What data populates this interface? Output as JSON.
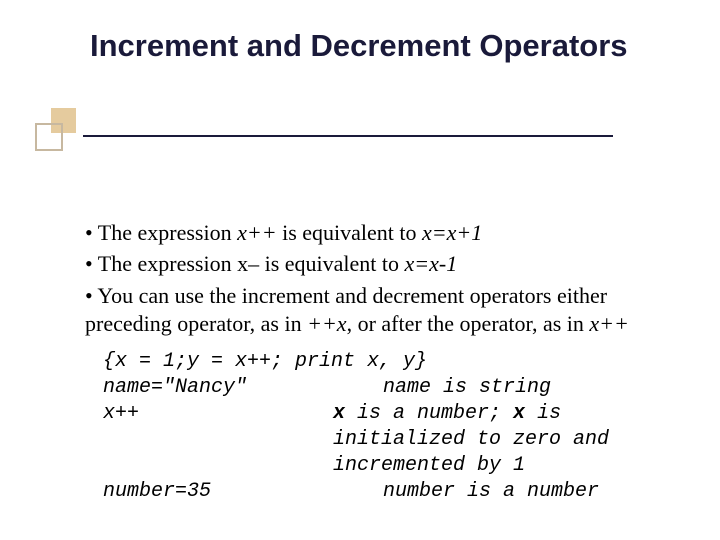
{
  "title": "Increment and Decrement Operators",
  "bullets": {
    "b1_pre": "• The expression ",
    "b1_mid": "x++",
    "b1_post": " is equivalent to ",
    "b1_end": "x=x+1",
    "b2_pre": "• The expression x– is equivalent to ",
    "b2_end": "x=x-1",
    "b3_pre": "• You can use the increment and decrement operators either preceding operator, as in ",
    "b3_mid": "++x",
    "b3_post": ", or after the operator, as in ",
    "b3_end": "x++"
  },
  "code": {
    "line1": "{x = 1;y = x++; print x, y}",
    "row1_left": "name=\"Nancy\"",
    "row1_right": "name is string",
    "row2_left": "x++",
    "row2_right_a_pre": "x",
    "row2_right_a_mid": " is a number; ",
    "row2_right_a_post": "x",
    "row2_right_a_end": " is",
    "row2_right_b": "initialized to zero and",
    "row2_right_c": "incremented by 1",
    "row3_left": "number=35",
    "row3_right": "number is a number"
  }
}
